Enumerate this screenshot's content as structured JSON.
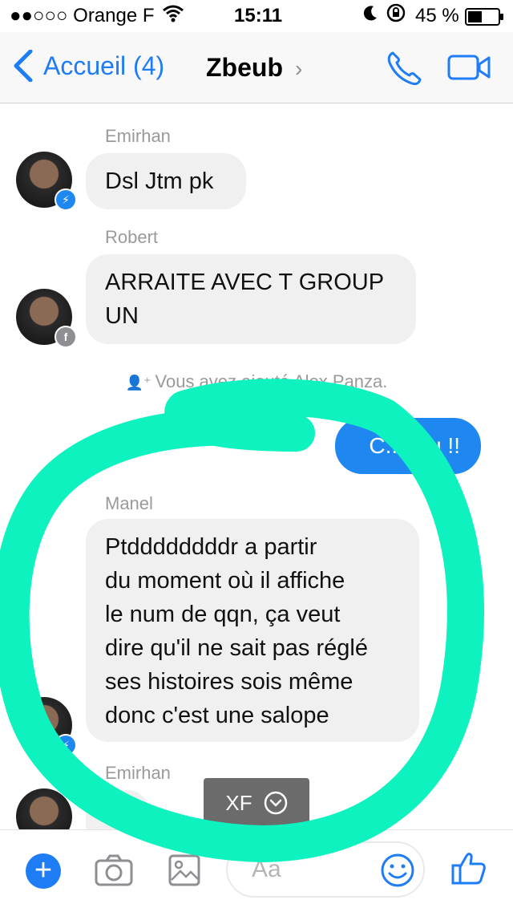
{
  "status": {
    "carrier": "●●○○○ Orange F",
    "time": "15:11",
    "battery": "45 %"
  },
  "nav": {
    "back_label": "Accueil (4)",
    "title": "Zbeub",
    "title_chevron": "›"
  },
  "messages": [
    {
      "sender": "Emirhan",
      "text": "Dsl Jtm pk"
    },
    {
      "sender": "Robert",
      "lines": [
        "ARRAITE AVEC T GROUP",
        "UN"
      ]
    },
    {
      "system": "Vous avez ajouté Alex Panza."
    },
    {
      "me_text": "C.....ou !!"
    },
    {
      "sender": "Manel",
      "lines": [
        "Ptddddddddr a partir",
        "du moment où il affiche",
        "le num de qqn, ça veut",
        "dire qu'il ne sait pas réglé",
        "ses histoires sois même",
        "donc c'est une salope"
      ]
    },
    {
      "sender": "Emirhan"
    }
  ],
  "toast": {
    "label": "XF"
  },
  "composer": {
    "placeholder": "Aa"
  },
  "colors": {
    "accent": "#1e7cf5",
    "bubble_gray": "#f1f0f0",
    "highlight": "#0ef2bf"
  }
}
